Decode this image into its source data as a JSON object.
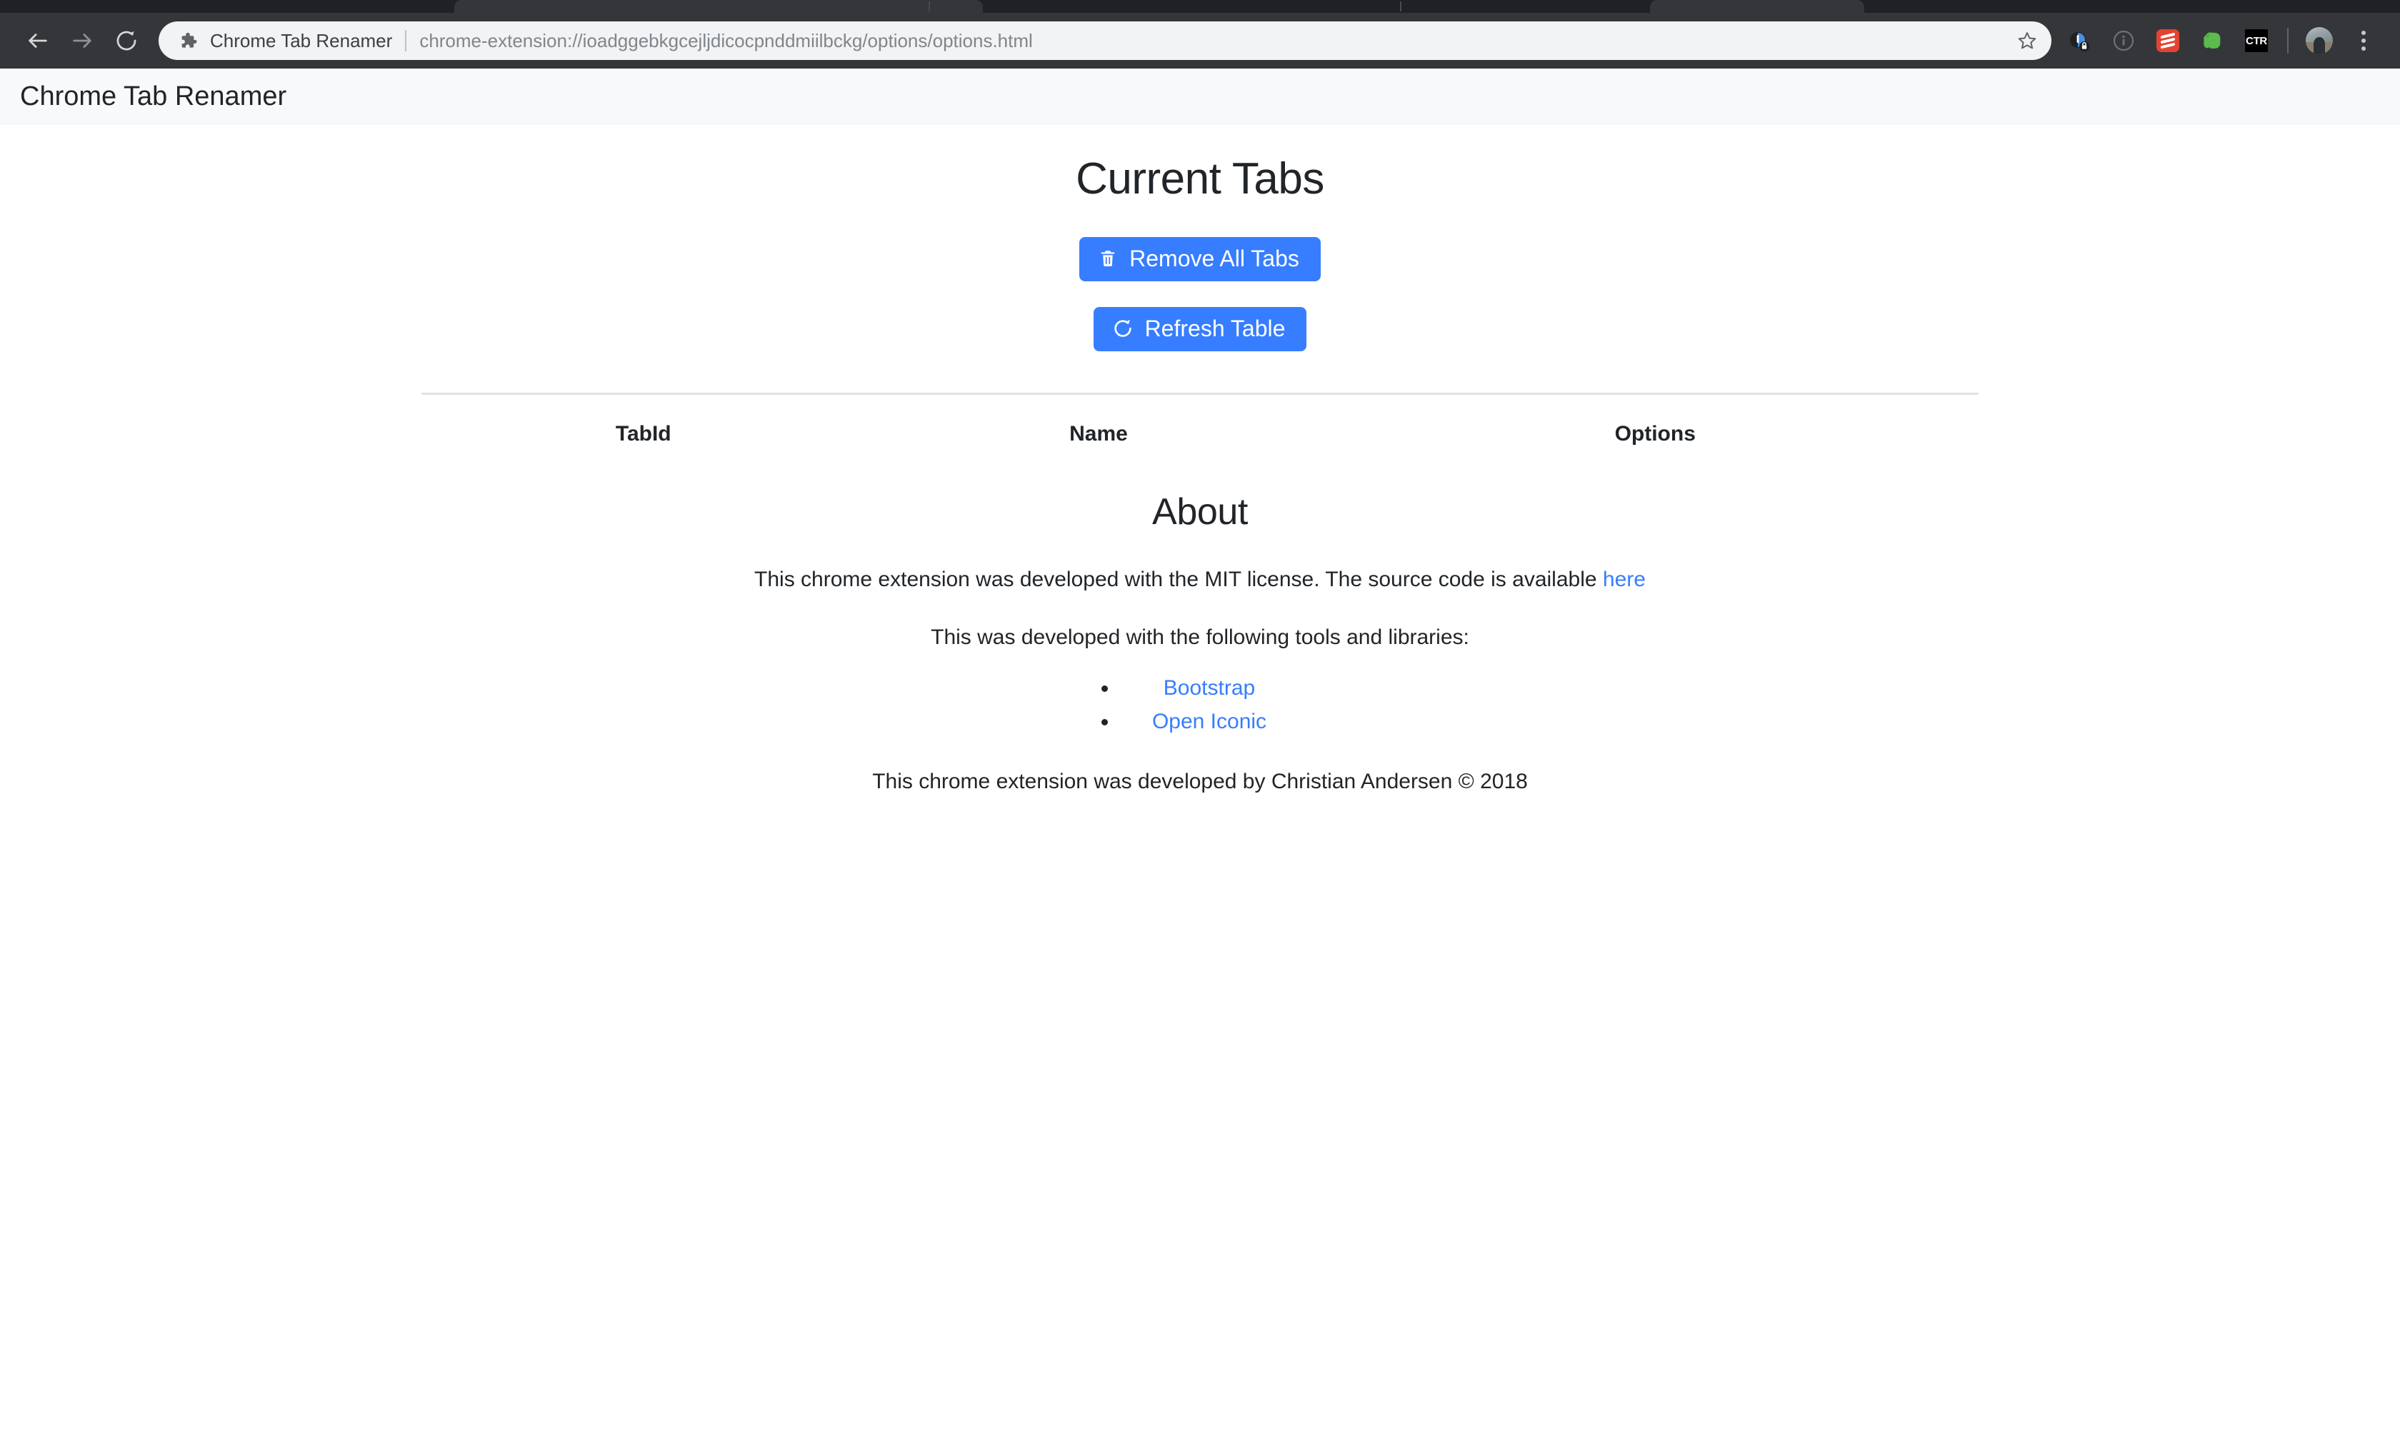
{
  "browser": {
    "nav": {
      "back_label": "Back",
      "forward_label": "Forward",
      "reload_label": "Reload this page"
    },
    "omnibox": {
      "extension_icon": "puzzle-piece-icon",
      "site_title": "Chrome Tab Renamer",
      "url": "chrome-extension://ioadggebkgcejljdicocpnddmiilbckg/options/options.html",
      "bookmark_icon": "star-icon"
    },
    "toolbar_icons": [
      {
        "name": "privacy-lock-extension-icon",
        "label": "Privacy extension"
      },
      {
        "name": "info-circle-extension-icon",
        "label": "Info extension"
      },
      {
        "name": "todoist-extension-icon",
        "label": "Todoist"
      },
      {
        "name": "evernote-extension-icon",
        "label": "Evernote"
      },
      {
        "name": "ctr-extension-icon",
        "label": "CTR"
      }
    ],
    "ctr_badge_text": "CTR",
    "profile_label": "Profile",
    "menu_label": "Customize and control Google Chrome"
  },
  "navbar": {
    "brand": "Chrome Tab Renamer"
  },
  "main": {
    "tabs_heading": "Current Tabs",
    "buttons": {
      "remove_all": "Remove All Tabs",
      "remove_all_icon": "trash-icon",
      "refresh": "Refresh Table",
      "refresh_icon": "reload-icon"
    },
    "table": {
      "columns": [
        "TabId",
        "Name",
        "Options"
      ],
      "rows": []
    }
  },
  "about": {
    "heading": "About",
    "license_text_before": "This chrome extension was developed with the MIT license. The source code is available ",
    "license_link": "here",
    "tools_intro": "This was developed with the following tools and libraries:",
    "tools": [
      {
        "label": "Bootstrap"
      },
      {
        "label": "Open Iconic"
      }
    ],
    "credit": "This chrome extension was developed by Christian Andersen © 2018"
  },
  "colors": {
    "primary": "#377dff",
    "link": "#377dff",
    "chrome_dark": "#35363a",
    "navbar_bg": "#f8f9fa"
  }
}
